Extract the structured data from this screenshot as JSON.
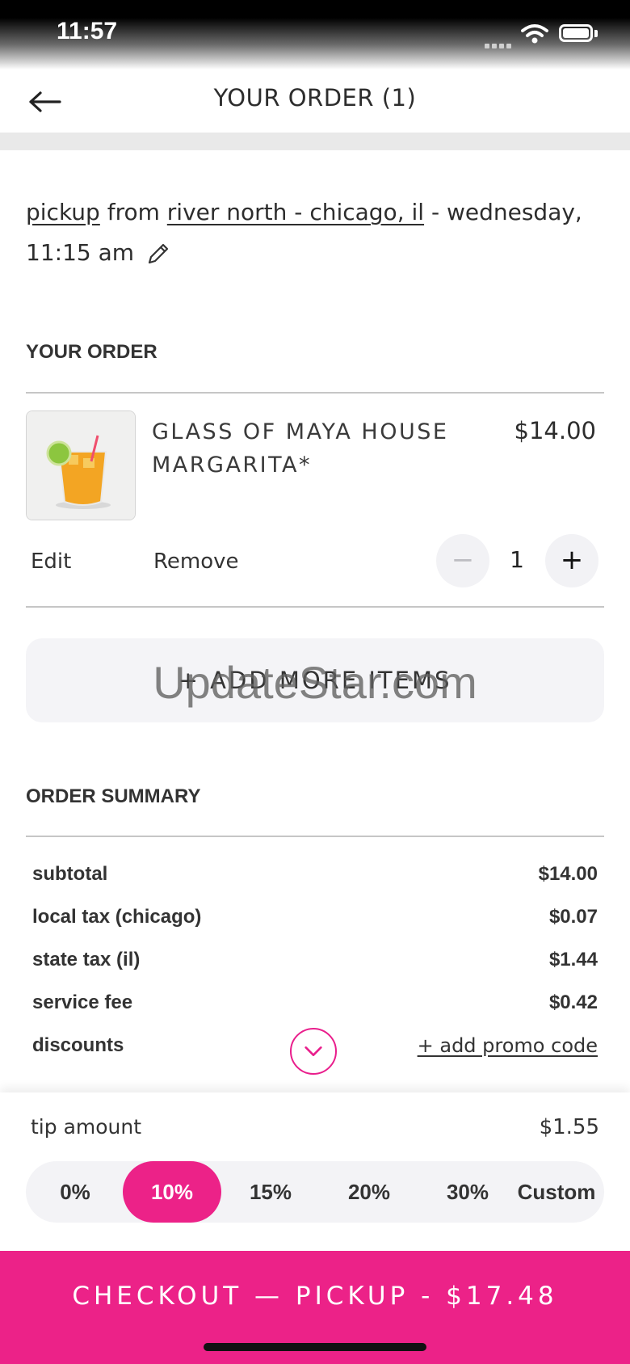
{
  "status_bar": {
    "time": "11:57"
  },
  "header": {
    "title": "YOUR ORDER (1)"
  },
  "pickup": {
    "mode": "pickup",
    "from_word": " from ",
    "location": "river north - chicago, il",
    "schedule": " - wednesday, 11:15 am"
  },
  "order": {
    "section_title": "YOUR ORDER",
    "items": [
      {
        "name": "GLASS OF MAYA HOUSE MARGARITA*",
        "price": "$14.00",
        "edit_label": "Edit",
        "remove_label": "Remove",
        "quantity": "1",
        "minus_label": "−",
        "plus_label": "+"
      }
    ],
    "add_more_label": "+ ADD MORE ITEMS"
  },
  "watermark": "UpdateStar.com",
  "summary": {
    "section_title": "ORDER SUMMARY",
    "rows": [
      {
        "label": "subtotal",
        "value": "$14.00"
      },
      {
        "label": "local tax (chicago)",
        "value": "$0.07"
      },
      {
        "label": "state tax (il)",
        "value": "$1.44"
      },
      {
        "label": "service fee",
        "value": "$0.42"
      }
    ],
    "discounts_label": "discounts",
    "promo_label": "+ add promo code"
  },
  "tip": {
    "label": "tip amount",
    "value": "$1.55",
    "options": [
      "0%",
      "10%",
      "15%",
      "20%",
      "30%",
      "Custom"
    ],
    "selected": "10%"
  },
  "checkout": {
    "label": "CHECKOUT — PICKUP - $17.48"
  },
  "colors": {
    "accent": "#ec2288",
    "divider": "#e9e9e9"
  },
  "icons": [
    "back-arrow-icon",
    "pencil-icon",
    "chevron-down-icon",
    "wifi-icon",
    "battery-icon",
    "signal-icon"
  ]
}
